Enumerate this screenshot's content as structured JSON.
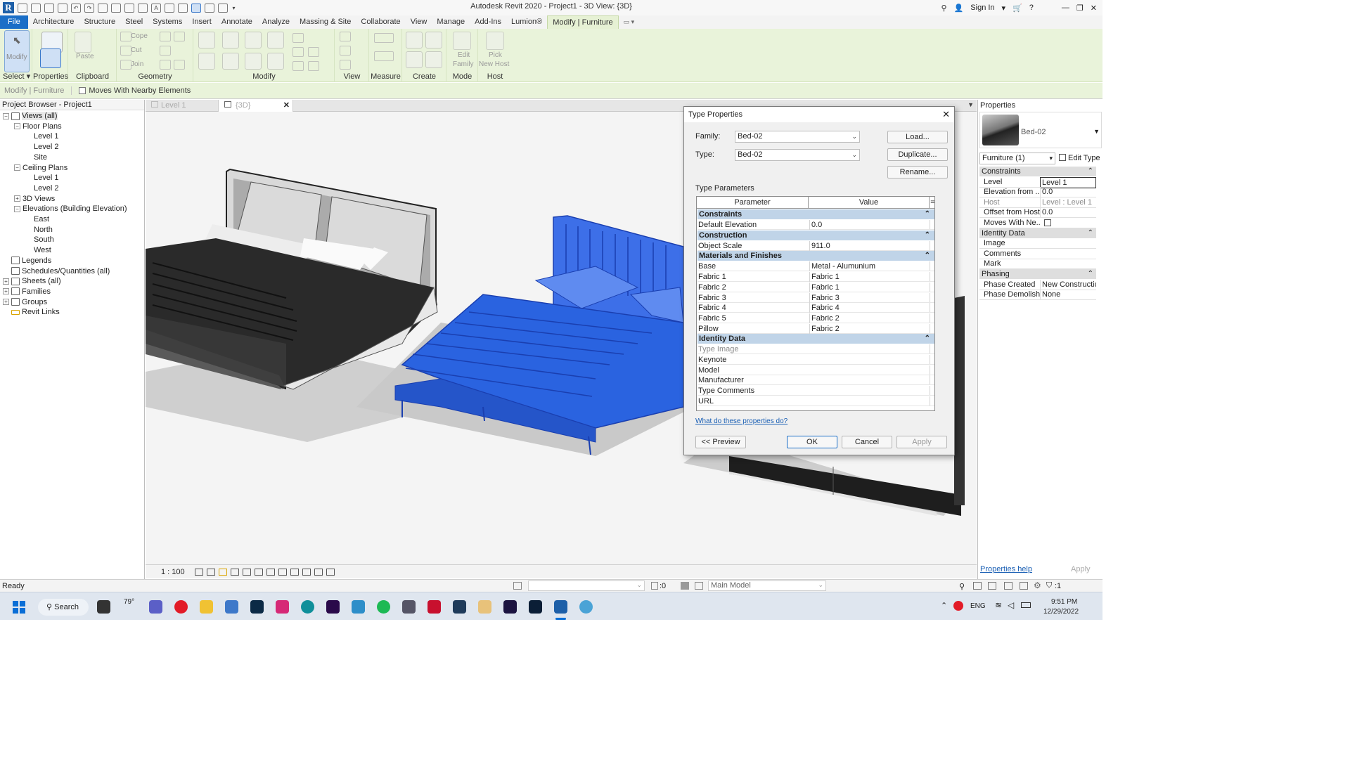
{
  "app": {
    "title": "Autodesk Revit 2020 - Project1 - 3D View: {3D}",
    "sign_in": "Sign In"
  },
  "ribbon": {
    "tabs": [
      "File",
      "Architecture",
      "Structure",
      "Steel",
      "Systems",
      "Insert",
      "Annotate",
      "Analyze",
      "Massing & Site",
      "Collaborate",
      "View",
      "Manage",
      "Add-Ins",
      "Lumion®",
      "Modify | Furniture"
    ],
    "active_tab": "Modify | Furniture",
    "panels": {
      "select": "Select",
      "properties": "Properties",
      "clipboard": "Clipboard",
      "geometry": "Geometry",
      "modify": "Modify",
      "view": "View",
      "measure": "Measure",
      "create": "Create",
      "mode": "Mode",
      "host": "Host"
    },
    "buttons": {
      "modify": "Modify",
      "paste": "Paste",
      "cope": "Cope",
      "cut": "Cut",
      "join": "Join",
      "edit_family_1": "Edit",
      "edit_family_2": "Family",
      "pick_host_1": "Pick",
      "pick_host_2": "New Host"
    }
  },
  "options_bar": {
    "context": "Modify | Furniture",
    "moves_with": "Moves With Nearby Elements"
  },
  "project_browser": {
    "title": "Project Browser - Project1",
    "items": [
      {
        "label": "Views (all)",
        "level": 0,
        "toggle": "−"
      },
      {
        "label": "Floor Plans",
        "level": 1,
        "toggle": "−"
      },
      {
        "label": "Level 1",
        "level": 2
      },
      {
        "label": "Level 2",
        "level": 2
      },
      {
        "label": "Site",
        "level": 2
      },
      {
        "label": "Ceiling Plans",
        "level": 1,
        "toggle": "−"
      },
      {
        "label": "Level 1",
        "level": 2
      },
      {
        "label": "Level 2",
        "level": 2
      },
      {
        "label": "3D Views",
        "level": 1,
        "toggle": "+"
      },
      {
        "label": "Elevations (Building Elevation)",
        "level": 1,
        "toggle": "−"
      },
      {
        "label": "East",
        "level": 2
      },
      {
        "label": "North",
        "level": 2
      },
      {
        "label": "South",
        "level": 2
      },
      {
        "label": "West",
        "level": 2
      },
      {
        "label": "Legends",
        "level": 0,
        "icon": true
      },
      {
        "label": "Schedules/Quantities (all)",
        "level": 0,
        "icon": true
      },
      {
        "label": "Sheets (all)",
        "level": 0,
        "icon": true,
        "toggle": "+"
      },
      {
        "label": "Families",
        "level": 0,
        "icon": true,
        "toggle": "+"
      },
      {
        "label": "Groups",
        "level": 0,
        "icon": true,
        "toggle": "+"
      },
      {
        "label": "Revit Links",
        "level": 0,
        "icon": true
      }
    ]
  },
  "view_tabs": [
    "Level 1",
    "{3D}"
  ],
  "view_control": {
    "scale": "1 : 100"
  },
  "type_properties": {
    "title": "Type Properties",
    "family_label": "Family:",
    "family_value": "Bed-02",
    "type_label": "Type:",
    "type_value": "Bed-02",
    "load": "Load...",
    "duplicate": "Duplicate...",
    "rename": "Rename...",
    "type_parameters": "Type Parameters",
    "col_parameter": "Parameter",
    "col_value": "Value",
    "col_eq": "=",
    "groups": [
      {
        "name": "Constraints",
        "rows": [
          {
            "p": "Default Elevation",
            "v": "0.0"
          }
        ]
      },
      {
        "name": "Construction",
        "rows": [
          {
            "p": "Object Scale",
            "v": "911.0"
          }
        ]
      },
      {
        "name": "Materials and Finishes",
        "rows": [
          {
            "p": "Base",
            "v": "Metal - Alumunium"
          },
          {
            "p": "Fabric 1",
            "v": "Fabric 1"
          },
          {
            "p": "Fabric 2",
            "v": "Fabric 1"
          },
          {
            "p": "Fabric 3",
            "v": "Fabric 3"
          },
          {
            "p": "Fabric 4",
            "v": "Fabric 4"
          },
          {
            "p": "Fabric 5",
            "v": "Fabric 2"
          },
          {
            "p": "Pillow",
            "v": "Fabric 2"
          }
        ]
      },
      {
        "name": "Identity Data",
        "rows": [
          {
            "p": "Type Image",
            "v": "",
            "gray": true
          },
          {
            "p": "Keynote",
            "v": ""
          },
          {
            "p": "Model",
            "v": ""
          },
          {
            "p": "Manufacturer",
            "v": ""
          },
          {
            "p": "Type Comments",
            "v": ""
          },
          {
            "p": "URL",
            "v": ""
          }
        ]
      }
    ],
    "help_link": "What do these properties do?",
    "preview": "<< Preview",
    "ok": "OK",
    "cancel": "Cancel",
    "apply": "Apply"
  },
  "properties": {
    "title": "Properties",
    "family_name": "Bed-02",
    "selector": "Furniture (1)",
    "edit_type": "Edit Type",
    "groups": [
      {
        "name": "Constraints",
        "rows": [
          {
            "k": "Level",
            "v": "Level 1"
          },
          {
            "k": "Elevation from ...",
            "v": "0.0"
          },
          {
            "k": "Host",
            "v": "Level : Level 1",
            "gray": true
          },
          {
            "k": "Offset from Host",
            "v": "0.0"
          },
          {
            "k": "Moves With Ne...",
            "v": "",
            "check": true
          }
        ]
      },
      {
        "name": "Identity Data",
        "rows": [
          {
            "k": "Image",
            "v": ""
          },
          {
            "k": "Comments",
            "v": ""
          },
          {
            "k": "Mark",
            "v": ""
          }
        ]
      },
      {
        "name": "Phasing",
        "rows": [
          {
            "k": "Phase Created",
            "v": "New Construction"
          },
          {
            "k": "Phase Demolish...",
            "v": "None"
          }
        ]
      }
    ],
    "help": "Properties help",
    "apply": "Apply"
  },
  "status": {
    "text": "Ready",
    "selection_count": ":0",
    "workset": "Main Model",
    "filter_count": ":1"
  },
  "taskbar": {
    "search": "Search",
    "weather": "79°",
    "lang": "ENG",
    "time": "9:51 PM",
    "date": "12/29/2022"
  },
  "colors": {
    "accent": "#1a6ec7",
    "ribbon": "#e9f3da",
    "bed_blue": "#2a63e0",
    "dialog_header": "#c0d4e8"
  }
}
